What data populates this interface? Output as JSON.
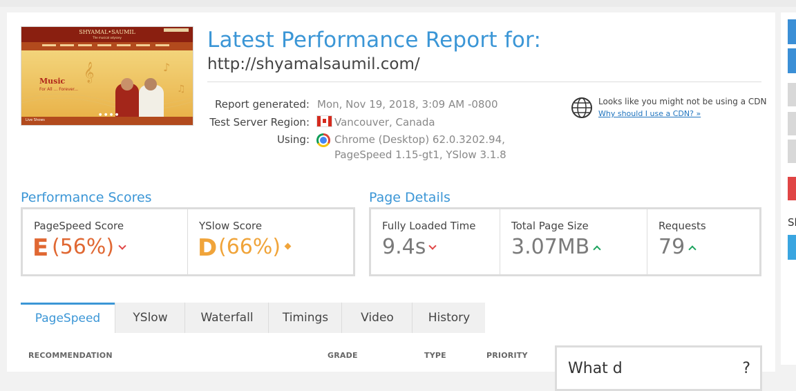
{
  "header": {
    "title": "Latest Performance Report for:",
    "url": "http://shyamalsaumil.com/"
  },
  "thumbnail": {
    "site_name": "SHYAMAL•SAUMIL",
    "subtitle": "The musical odyssey",
    "banner_heading": "Music",
    "banner_tagline": "For All ... Forever...",
    "footer_label": "Live Shows"
  },
  "report": {
    "generated_label": "Report generated:",
    "generated_value": "Mon, Nov 19, 2018, 3:09 AM -0800",
    "region_label": "Test Server Region:",
    "region_value": "Vancouver, Canada",
    "using_label": "Using:",
    "using_line1": "Chrome (Desktop) 62.0.3202.94,",
    "using_line2": "PageSpeed 1.15-gt1, YSlow 3.1.8"
  },
  "cdn": {
    "text": "Looks like you might not be using a CDN",
    "link": "Why should I use a CDN? »"
  },
  "scores": {
    "section_title": "Performance Scores",
    "pagespeed": {
      "label": "PageSpeed Score",
      "grade": "E",
      "percent": "(56%)",
      "color": "#e06833",
      "trend": "down"
    },
    "yslow": {
      "label": "YSlow Score",
      "grade": "D",
      "percent": "(66%)",
      "color": "#f0a43a",
      "trend": "neutral"
    }
  },
  "details": {
    "section_title": "Page Details",
    "load_time": {
      "label": "Fully Loaded Time",
      "value": "9.4s",
      "trend": "down"
    },
    "page_size": {
      "label": "Total Page Size",
      "value": "3.07MB",
      "trend": "up"
    },
    "requests": {
      "label": "Requests",
      "value": "79",
      "trend": "up"
    }
  },
  "tabs": [
    {
      "label": "PageSpeed",
      "active": true
    },
    {
      "label": "YSlow"
    },
    {
      "label": "Waterfall"
    },
    {
      "label": "Timings"
    },
    {
      "label": "Video"
    },
    {
      "label": "History"
    }
  ],
  "table": {
    "headers": [
      "RECOMMENDATION",
      "GRADE",
      "TYPE",
      "PRIORITY"
    ]
  },
  "side_panel": {
    "title": "What d",
    "question_mark": "?"
  },
  "right_sidebar": {
    "label": "Sh",
    "colors": [
      "#3b8fd6",
      "#3b8fd6",
      "#d8d8d8",
      "#d8d8d8",
      "#d8d8d8",
      "#e04545",
      "#3aa5e0"
    ]
  },
  "icons": {
    "globe": "globe-icon",
    "flag": "canada-flag-icon",
    "browser": "chrome-icon"
  }
}
